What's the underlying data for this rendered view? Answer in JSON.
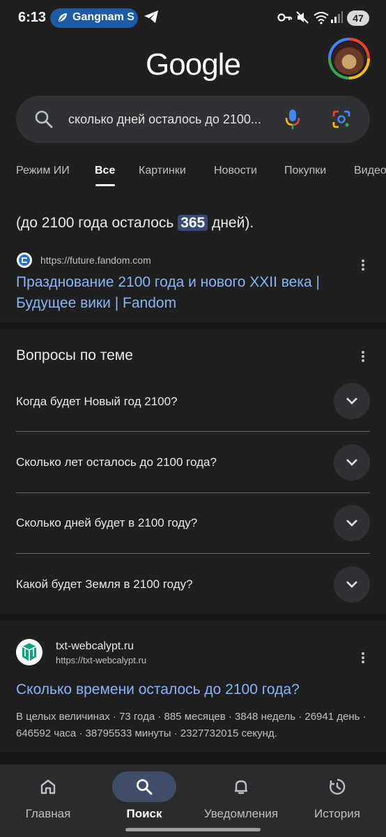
{
  "status_bar": {
    "time": "6:13",
    "notification_pill": "Gangnam S",
    "battery": "47"
  },
  "header": {
    "logo": "Google"
  },
  "search": {
    "query": "сколько дней осталось до 2100..."
  },
  "tabs": [
    {
      "label": "Режим ИИ"
    },
    {
      "label": "Все"
    },
    {
      "label": "Картинки"
    },
    {
      "label": "Новости"
    },
    {
      "label": "Покупки"
    },
    {
      "label": "Видео"
    }
  ],
  "snippet": {
    "before": "(до 2100 года осталось ",
    "highlight": "365",
    "after": " дней)."
  },
  "result1": {
    "url": "https://future.fandom.com",
    "title": "Празднование 2100 года и нового XXII века | Будущее вики | Fandom"
  },
  "paa": {
    "title": "Вопросы по теме",
    "questions": [
      {
        "text": "Когда будет Новый год 2100?"
      },
      {
        "text": "Сколько лет осталось до 2100 года?"
      },
      {
        "text": "Сколько дней будет в 2100 году?"
      },
      {
        "text": "Какой будет Земля в 2100 году?"
      }
    ]
  },
  "result2": {
    "site_name": "txt-webcalypt.ru",
    "url": "https://txt-webcalypt.ru",
    "title": "Сколько времени осталось до 2100 года?",
    "description": "В целых величинах · 73 года · 885 месяцев · 3848 недель · 26941 день · 646592 часа · 38795533 минуты · 2327732015 секунд."
  },
  "bottom_nav": [
    {
      "label": "Главная",
      "icon": "home-icon"
    },
    {
      "label": "Поиск",
      "icon": "search-icon"
    },
    {
      "label": "Уведомления",
      "icon": "bell-icon"
    },
    {
      "label": "История",
      "icon": "history-icon"
    }
  ],
  "colors": {
    "background": "#1f1f1f",
    "link": "#8ab4f8",
    "highlight": "#394a7a",
    "nav_active": "#3f4d68"
  }
}
